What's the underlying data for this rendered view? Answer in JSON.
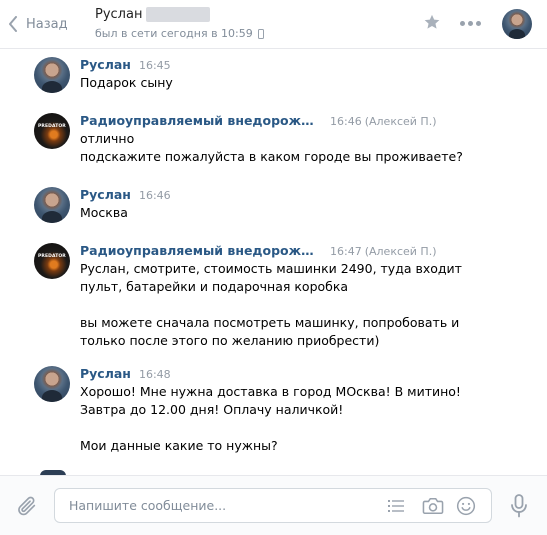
{
  "header": {
    "back_label": "Назад",
    "peer_name": "Руслан",
    "peer_status": "был в сети сегодня в 10:59",
    "icons": {
      "back": "chevron-left-icon",
      "star": "star-icon",
      "more": "more-horizontal-icon",
      "status_device": "mobile-phone-icon"
    }
  },
  "messages": [
    {
      "author": "Руслан",
      "time": "16:45",
      "sender_note": "",
      "lines": [
        "Подарок сыну"
      ],
      "avatar": "user-avatar"
    },
    {
      "author": "Радиоуправляемый внедорожник-пер...",
      "time": "16:46",
      "sender_note": "(Алексей П.)",
      "lines": [
        "отлично",
        "подскажите пожалуйста в каком городе вы проживаете?"
      ],
      "avatar": "shop-avatar",
      "avatar_text": "PREDATOR"
    },
    {
      "author": "Руслан",
      "time": "16:46",
      "sender_note": "",
      "lines": [
        "Москва"
      ],
      "avatar": "user-avatar"
    },
    {
      "author": "Радиоуправляемый внедорожник-пер...",
      "time": "16:47",
      "sender_note": "(Алексей П.)",
      "lines": [
        "Руслан, смотрите, стоимость машинки 2490, туда входит",
        "пульт, батарейки и подарочная коробка",
        "",
        "вы можете сначала посмотреть машинку, попробовать и",
        "только после этого по желанию приобрести)"
      ],
      "avatar": "shop-avatar",
      "avatar_text": "PREDATOR"
    },
    {
      "author": "Руслан",
      "time": "16:48",
      "sender_note": "",
      "lines": [
        "Хорошо! Мне нужна доставка в город МОсква! В митино!",
        "Завтра до 12.00 дня! Оплачу наличкой!",
        "",
        "Мои данные какие то нужны?"
      ],
      "avatar": "user-avatar"
    }
  ],
  "composer": {
    "placeholder": "Напишите сообщение...",
    "value": "",
    "icons": {
      "attach": "paperclip-icon",
      "templates": "list-icon",
      "camera": "camera-icon",
      "emoji": "smile-icon",
      "voice": "microphone-icon"
    }
  },
  "colors": {
    "link": "#2a5885",
    "muted": "#818c99",
    "border": "#e7e8ec",
    "icon": "#99a2ad"
  }
}
